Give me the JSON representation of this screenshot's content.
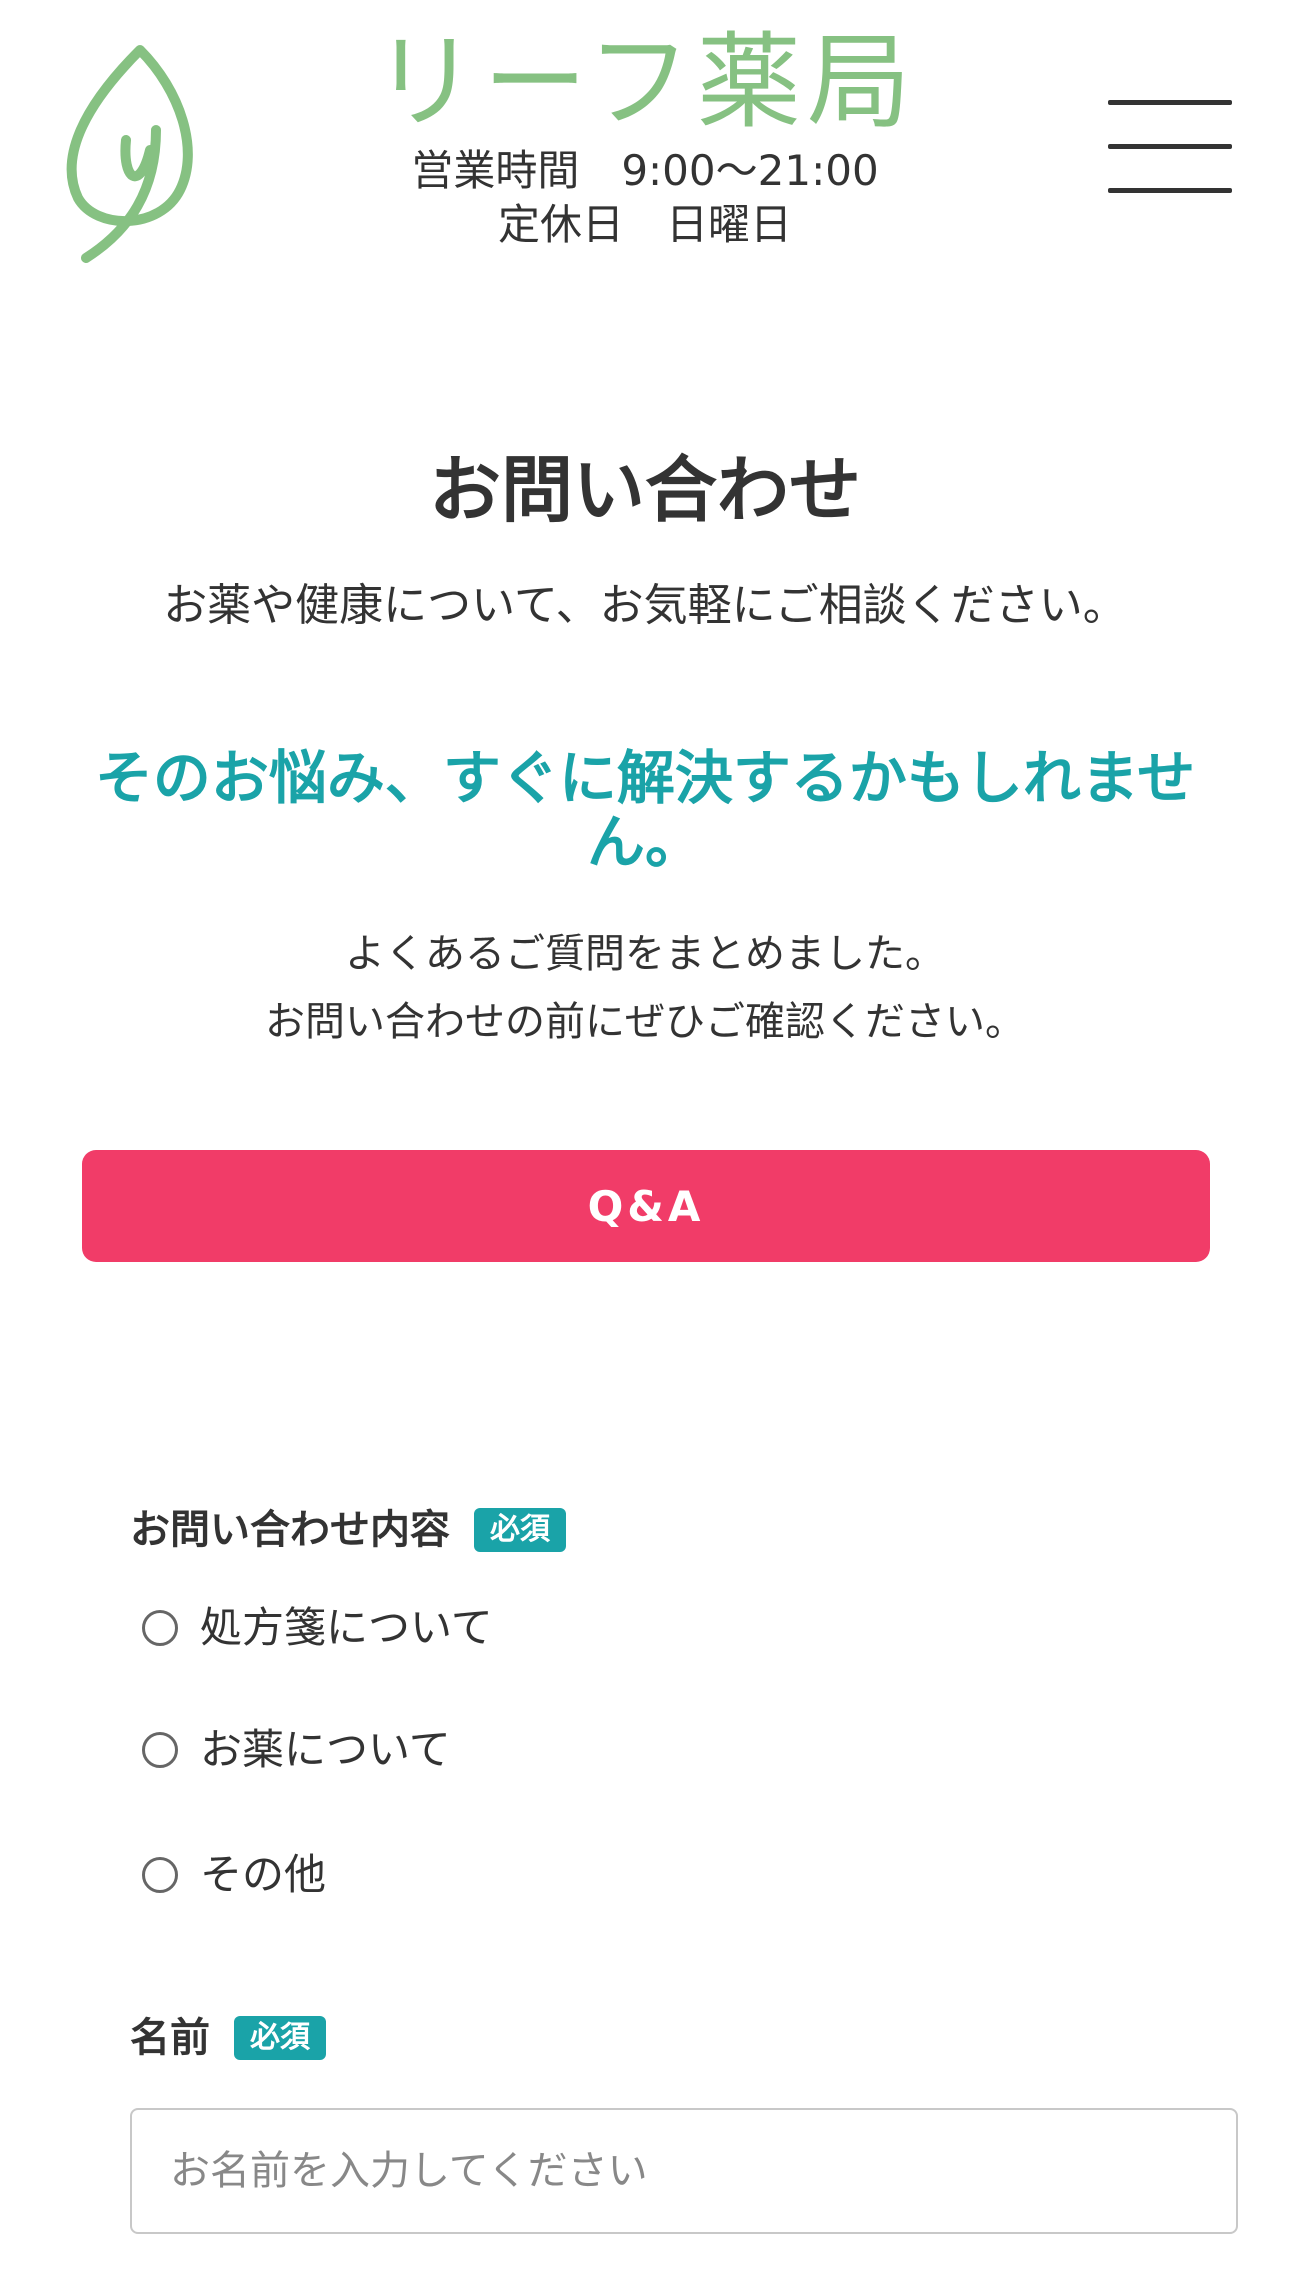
{
  "header": {
    "brand_name": "リーフ薬局",
    "hours": "営業時間　9:00〜21:00",
    "closed_day": "定休日　日曜日",
    "logo_icon": "leaf-icon",
    "menu_icon": "hamburger-menu-icon",
    "brand_color": "#86c182"
  },
  "main": {
    "title": "お問い合わせ",
    "intro": "お薬や健康について、お気軽にご相談ください。",
    "faq_heading": "そのお悩み、すぐに解決するかもしれません。",
    "faq_text_line1": "よくあるご質問をまとめました。",
    "faq_text_line2": "お問い合わせの前にぜひご確認ください。",
    "qa_button_label": "Q&A",
    "accent_color": "#1aa3a8",
    "button_color": "#f13c68"
  },
  "form": {
    "inquiry_type": {
      "label": "お問い合わせ内容",
      "required_badge": "必須",
      "options": [
        "処方箋について",
        "お薬について",
        "その他"
      ]
    },
    "name": {
      "label": "名前",
      "required_badge": "必須",
      "placeholder": "お名前を入力してください",
      "value": ""
    }
  }
}
